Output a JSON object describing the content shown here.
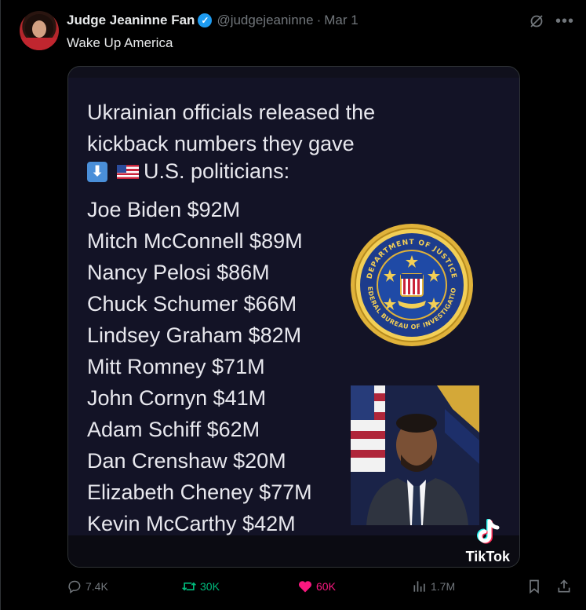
{
  "post": {
    "author_name": "Judge Jeaninne Fan",
    "handle": "@judgejeaninne",
    "separator": "·",
    "date": "Mar 1",
    "text": "Wake Up America"
  },
  "media": {
    "headline": "Ukrainian officials released the kickback numbers they gave",
    "subhead": "U.S. politicians:",
    "list": [
      "Joe Biden $92M",
      "Mitch McConnell $89M",
      "Nancy Pelosi $86M",
      "Chuck Schumer $66M",
      "Lindsey Graham $82M",
      "Mitt Romney $71M",
      "John Cornyn $41M",
      "Adam Schiff $62M",
      "Dan Crenshaw $20M",
      "Elizabeth Cheney $77M",
      "Kevin McCarthy $42M"
    ],
    "seal_text_top": "DEPARTMENT OF JUSTICE",
    "seal_text_bottom": "FEDERAL BUREAU OF INVESTIGATION",
    "seal_banner": "FIDELITY BRAVERY INTEGRITY",
    "watermark": "TikTok"
  },
  "actions": {
    "replies": "7.4K",
    "reposts": "30K",
    "likes": "60K",
    "views": "1.7M"
  },
  "colors": {
    "background": "#000000",
    "accent_blue": "#1d9bf0",
    "retweet_green": "#00ba7c",
    "like_pink": "#f91880",
    "muted": "#71767b"
  },
  "icons": [
    "verified-badge-icon",
    "grok-icon",
    "more-icon",
    "reply-icon",
    "retweet-icon",
    "heart-icon",
    "views-icon",
    "bookmark-icon",
    "share-icon",
    "tiktok-logo-icon"
  ]
}
